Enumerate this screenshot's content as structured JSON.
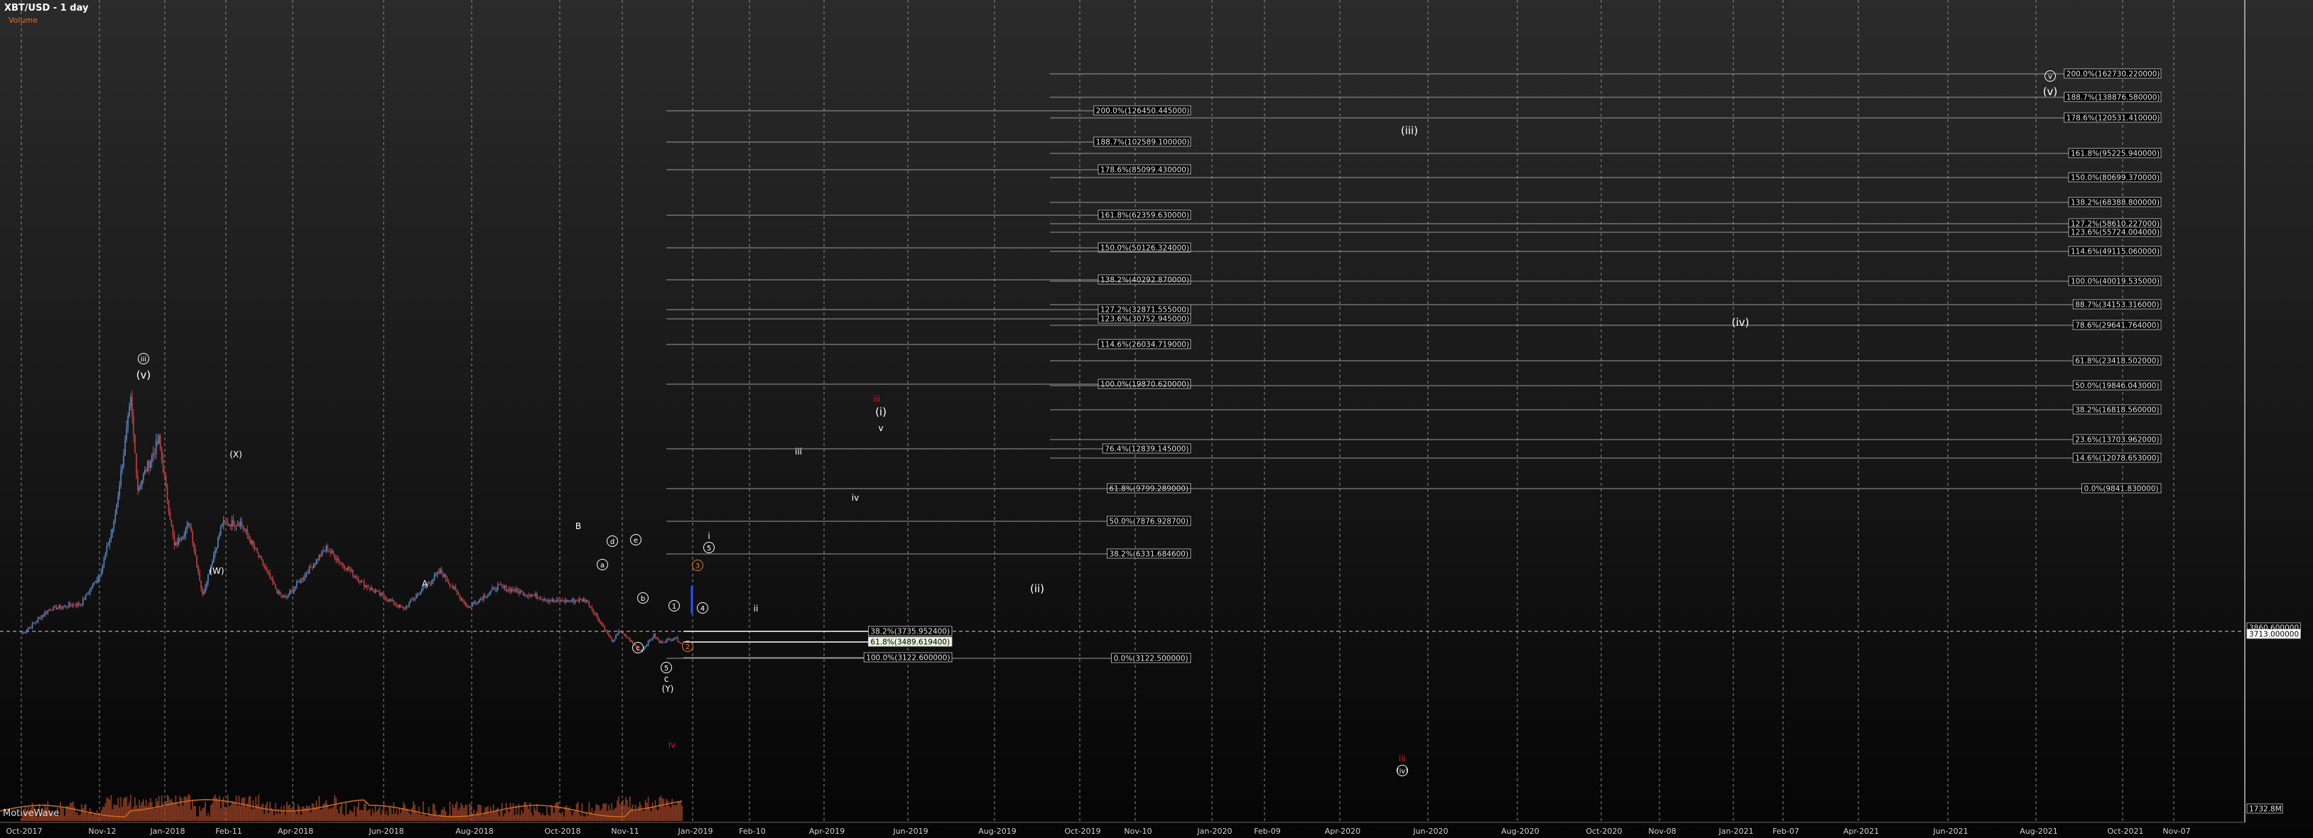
{
  "header": {
    "title": "XBT/USD - 1 day",
    "subtitle": "Volume"
  },
  "watermark": "MotiveWave",
  "colors": {
    "background_top": "#2b2b2b",
    "background_bottom": "#050505",
    "grid": "#8a8a8a",
    "up_candle": "#5a88c8",
    "down_candle": "#c84040",
    "volume": "#b04a2a",
    "volume_line": "#d06a20",
    "fib_line": "#9a9a9a",
    "wave_label": "#ffffff",
    "wave_label_red": "#d02020",
    "wave_label_orange": "#e08020"
  },
  "chart_data": {
    "type": "candlestick",
    "title": "XBT/USD - 1 day",
    "x_tick_labels": [
      "Oct-2017",
      "Nov-12",
      "Jan-2018",
      "Feb-11",
      "Apr-2018",
      "Jun-2018",
      "Aug-2018",
      "Oct-2018",
      "Nov-11",
      "Jan-2019",
      "Feb-10",
      "Apr-2019",
      "Jun-2019",
      "Aug-2019",
      "Oct-2019",
      "Nov-10",
      "Jan-2020",
      "Feb-09",
      "Apr-2020",
      "Jun-2020",
      "Aug-2020",
      "Oct-2020",
      "Nov-08",
      "Jan-2021",
      "Feb-07",
      "Apr-2021",
      "Jun-2021",
      "Aug-2021",
      "Oct-2021",
      "Nov-07"
    ],
    "price_path": [
      [
        "2017-10-01",
        4300
      ],
      [
        "2017-10-20",
        5900
      ],
      [
        "2017-11-12",
        6300
      ],
      [
        "2017-11-25",
        8200
      ],
      [
        "2017-12-05",
        11500
      ],
      [
        "2017-12-17",
        19500
      ],
      [
        "2017-12-22",
        13800
      ],
      [
        "2018-01-06",
        17000
      ],
      [
        "2018-01-17",
        10000
      ],
      [
        "2018-01-28",
        11500
      ],
      [
        "2018-02-06",
        6800
      ],
      [
        "2018-02-20",
        11500
      ],
      [
        "2018-03-05",
        11600
      ],
      [
        "2018-04-01",
        6900
      ],
      [
        "2018-04-06",
        6600
      ],
      [
        "2018-05-05",
        9900
      ],
      [
        "2018-06-01",
        7500
      ],
      [
        "2018-06-29",
        5900
      ],
      [
        "2018-07-25",
        8400
      ],
      [
        "2018-08-14",
        6000
      ],
      [
        "2018-09-04",
        7400
      ],
      [
        "2018-10-15",
        6400
      ],
      [
        "2018-11-06",
        6500
      ],
      [
        "2018-11-25",
        3700
      ],
      [
        "2018-11-29",
        4500
      ],
      [
        "2018-12-15",
        3150
      ],
      [
        "2018-12-24",
        4200
      ],
      [
        "2018-12-28",
        3700
      ],
      [
        "2019-01-04",
        3900
      ],
      [
        "2019-01-08",
        4050
      ],
      [
        "2019-01-14",
        3550
      ]
    ],
    "last_price": "3713.000000",
    "right_axis_labels": [
      "3860.600000",
      "3713.000000",
      "1732.8M"
    ],
    "fib_levels_a": [
      "200.0%(126450.445000)",
      "188.7%(102589.100000)",
      "178.6%(85099.430000)",
      "161.8%(62359.630000)",
      "150.0%(50126.324000)",
      "138.2%(40292.870000)",
      "127.2%(32871.555000)",
      "123.6%(30752.945000)",
      "114.6%(26034.719000)",
      "100.0%(19870.620000)",
      "76.4%(12839.145000)",
      "61.8%(9799.289000)",
      "50.0%(7876.928700)",
      "38.2%(6331.684600)",
      "0.0%(3122.500000)"
    ],
    "fib_levels_b": [
      "200.0%(162730.220000)",
      "188.7%(138876.580000)",
      "178.6%(120531.410000)",
      "161.8%(95225.940000)",
      "150.0%(80699.370000)",
      "138.2%(68388.800000)",
      "127.2%(58610.227000)",
      "123.6%(55724.004000)",
      "114.6%(49115.060000)",
      "100.0%(40019.535000)",
      "88.7%(34153.316000)",
      "78.6%(29641.764000)",
      "61.8%(23418.502000)",
      "50.0%(19846.043000)",
      "38.2%(16818.560000)",
      "23.6%(13703.962000)",
      "14.6%(12078.653000)",
      "0.0%(9841.830000)"
    ],
    "fib_levels_c": [
      "38.2%(3735.952400)",
      "61.8%(3489.619400)",
      "100.0%(3122.600000)"
    ],
    "wave_labels": [
      "iii",
      "(v)",
      "(X)",
      "(W)",
      "A",
      "B",
      "a",
      "b",
      "c",
      "d",
      "e",
      "5",
      "c",
      "(Y)",
      "1",
      "2",
      "3",
      "4",
      "5",
      "i",
      "ii",
      "iii",
      "iv",
      "v",
      "(i)",
      "(ii)",
      "(iii)",
      "(iv)",
      "v",
      "(v)",
      "(iv)",
      "iv",
      "iii",
      "iii"
    ]
  }
}
